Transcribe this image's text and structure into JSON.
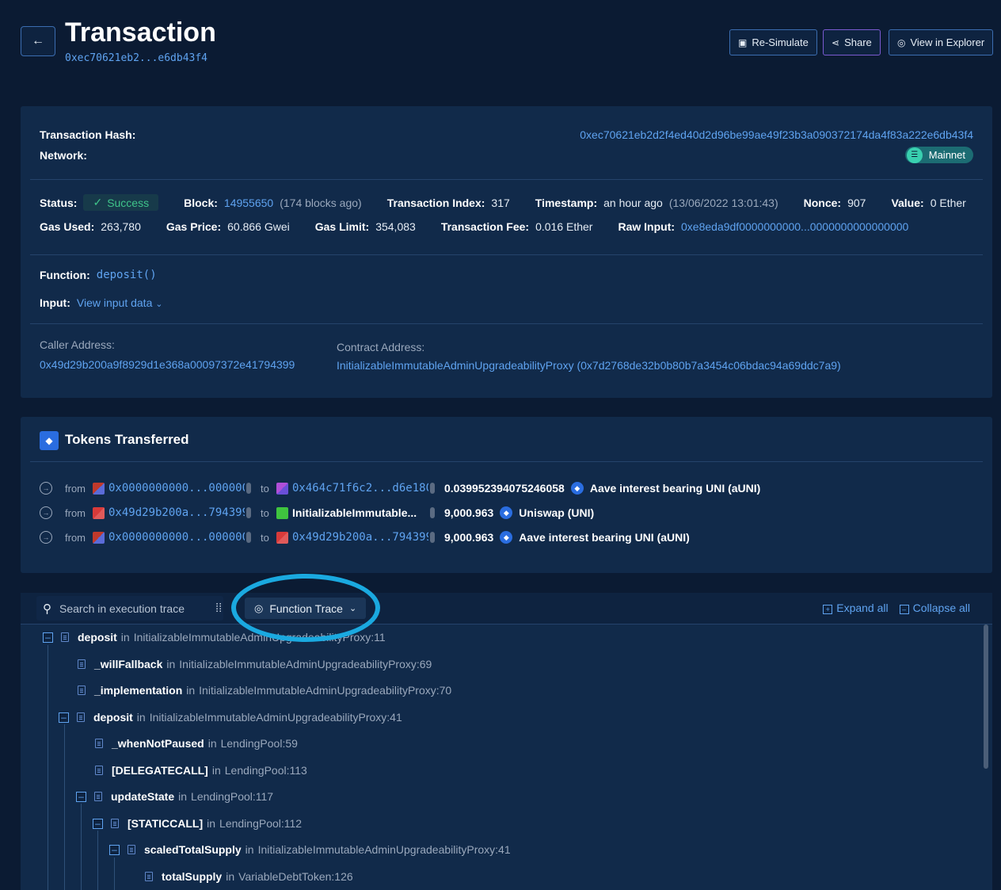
{
  "header": {
    "title": "Transaction",
    "hash_short": "0xec70621eb2...e6db43f4",
    "buttons": {
      "resimulate": "Re-Simulate",
      "share": "Share",
      "explorer": "View in Explorer"
    }
  },
  "details": {
    "tx_hash_label": "Transaction Hash:",
    "tx_hash": "0xec70621eb2d2f4ed40d2d96be99ae49f23b3a090372174da4f83a222e6db43f4",
    "network_label": "Network:",
    "network": "Mainnet",
    "status_label": "Status:",
    "status": "Success",
    "block_label": "Block:",
    "block": "14955650",
    "block_ago": "(174 blocks ago)",
    "tx_index_label": "Transaction Index:",
    "tx_index": "317",
    "timestamp_label": "Timestamp:",
    "timestamp": "an hour ago",
    "timestamp_full": "(13/06/2022 13:01:43)",
    "nonce_label": "Nonce:",
    "nonce": "907",
    "value_label": "Value:",
    "value": "0 Ether",
    "gas_used_label": "Gas Used:",
    "gas_used": "263,780",
    "gas_price_label": "Gas Price:",
    "gas_price": "60.866 Gwei",
    "gas_limit_label": "Gas Limit:",
    "gas_limit": "354,083",
    "tx_fee_label": "Transaction Fee:",
    "tx_fee": "0.016 Ether",
    "raw_input_label": "Raw Input:",
    "raw_input": "0xe8eda9df0000000000...0000000000000000",
    "function_label": "Function:",
    "function": "deposit()",
    "input_label": "Input:",
    "input_link": "View input data",
    "caller_label": "Caller Address:",
    "caller": "0x49d29b200a9f8929d1e368a00097372e41794399",
    "contract_label": "Contract Address:",
    "contract": "InitializableImmutableAdminUpgradeabilityProxy (0x7d2768de32b0b80b7a3454c06bdac94a69ddc7a9)"
  },
  "tokens": {
    "title": "Tokens Transferred",
    "from_label": "from",
    "to_label": "to",
    "rows": [
      {
        "from": "0x0000000000...000000",
        "to": "0x464c71f6c2...d6e180",
        "amount": "0.039952394075246058",
        "token": "Aave interest bearing UNI (aUNI)"
      },
      {
        "from": "0x49d29b200a...794399",
        "to": "InitializableImmutable...",
        "amount": "9,000.963",
        "token": "Uniswap (UNI)"
      },
      {
        "from": "0x0000000000...000000",
        "to": "0x49d29b200a...794399",
        "amount": "9,000.963",
        "token": "Aave interest bearing UNI (aUNI)"
      }
    ]
  },
  "trace": {
    "search_placeholder": "Search in execution trace",
    "mode": "Function Trace",
    "expand_all": "Expand all",
    "collapse_all": "Collapse all",
    "in_label": "in",
    "nodes": [
      {
        "fn": "deposit",
        "loc": "InitializableImmutableAdminUpgradeabilityProxy:11"
      },
      {
        "fn": "_willFallback",
        "loc": "InitializableImmutableAdminUpgradeabilityProxy:69"
      },
      {
        "fn": "_implementation",
        "loc": "InitializableImmutableAdminUpgradeabilityProxy:70"
      },
      {
        "fn": "deposit",
        "loc": "InitializableImmutableAdminUpgradeabilityProxy:41"
      },
      {
        "fn": "_whenNotPaused",
        "loc": "LendingPool:59"
      },
      {
        "fn": "[DELEGATECALL]",
        "loc": "LendingPool:113"
      },
      {
        "fn": "updateState",
        "loc": "LendingPool:117"
      },
      {
        "fn": "[STATICCALL]",
        "loc": "LendingPool:112"
      },
      {
        "fn": "scaledTotalSupply",
        "loc": "InitializableImmutableAdminUpgradeabilityProxy:41"
      },
      {
        "fn": "totalSupply",
        "loc": "VariableDebtToken:126"
      }
    ]
  }
}
